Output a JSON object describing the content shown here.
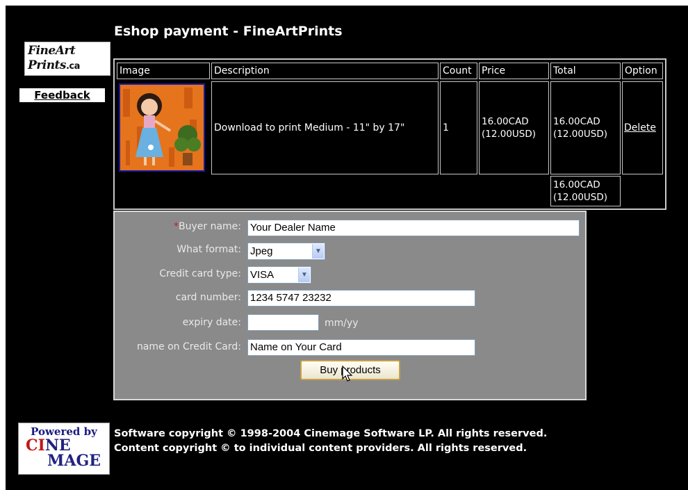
{
  "page": {
    "title": "Eshop payment - FineArtPrints",
    "logo_line1": "FineArt",
    "logo_line2": "Prints",
    "logo_suffix": ".ca",
    "feedback_label": "Feedback"
  },
  "cart": {
    "headers": [
      "Image",
      "Description",
      "Count",
      "Price",
      "Total",
      "Option"
    ],
    "rows": [
      {
        "image_icon": "artwork-thumbnail-woman-blue-dress",
        "description": "Download to print Medium - 11\" by 17\"",
        "count": "1",
        "price_cad": "16.00CAD",
        "price_usd": "(12.00USD)",
        "total_cad": "16.00CAD",
        "total_usd": "(12.00USD)",
        "option_label": "Delete"
      }
    ],
    "grand_total_cad": "16.00CAD",
    "grand_total_usd": "(12.00USD)"
  },
  "form": {
    "required_mark": "*",
    "buyer_name_label": "Buyer name:",
    "buyer_name_value": "Your Dealer Name",
    "format_label": "What format:",
    "format_value": "Jpeg",
    "card_type_label": "Credit card type:",
    "card_type_value": "VISA",
    "card_number_label": "card number:",
    "card_number_value": "1234 5747 23232",
    "expiry_label": "expiry date:",
    "expiry_value": "",
    "expiry_hint": "mm/yy",
    "name_on_card_label": "name on Credit Card:",
    "name_on_card_value": "Name on Your Card",
    "submit_label": "Buy products"
  },
  "footer": {
    "powered_by": "Powered by",
    "brand_line1_red": "CI",
    "brand_line1_blue": "NE",
    "brand_line2": "MAGE",
    "copyright_line1": "Software copyright © 1998-2004 Cinemage Software LP. All rights reserved.",
    "copyright_line2": "Content copyright © to individual content providers. All rights reserved."
  },
  "colors": {
    "background": "#000000",
    "form_background": "#8a8a8a",
    "required": "#d01818",
    "thumbnail_border": "#1a1aa8"
  }
}
